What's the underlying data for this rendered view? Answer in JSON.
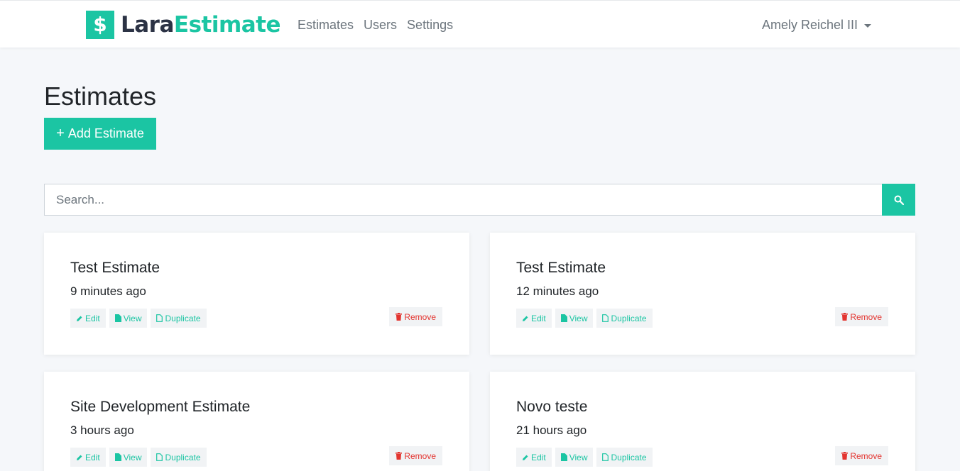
{
  "brand": {
    "badge": "$",
    "name_part1": "Lara",
    "name_part2": "Estimate"
  },
  "nav": {
    "links": [
      {
        "label": "Estimates"
      },
      {
        "label": "Users"
      },
      {
        "label": "Settings"
      }
    ],
    "user": "Amely Reichel III"
  },
  "page": {
    "title": "Estimates",
    "add_plus": "+",
    "add_label": "Add Estimate"
  },
  "search": {
    "placeholder": "Search...",
    "value": ""
  },
  "estimates": [
    {
      "title": "Test Estimate",
      "time": "9 minutes ago"
    },
    {
      "title": "Test Estimate",
      "time": "12 minutes ago"
    },
    {
      "title": "Site Development Estimate",
      "time": "3 hours ago"
    },
    {
      "title": "Novo teste",
      "time": "21 hours ago"
    }
  ],
  "card_actions": {
    "edit": "Edit",
    "view": "View",
    "duplicate": "Duplicate",
    "remove": "Remove"
  },
  "colors": {
    "accent": "#1bc5a3",
    "danger": "#e3342f",
    "brand_dark": "#2c3345",
    "background": "#f5f7fa"
  },
  "icons": {
    "search": "search-icon",
    "edit": "pencil-icon",
    "view": "file-icon",
    "duplicate": "copy-icon",
    "remove": "trash-icon",
    "user_menu": "caret-down-icon"
  }
}
